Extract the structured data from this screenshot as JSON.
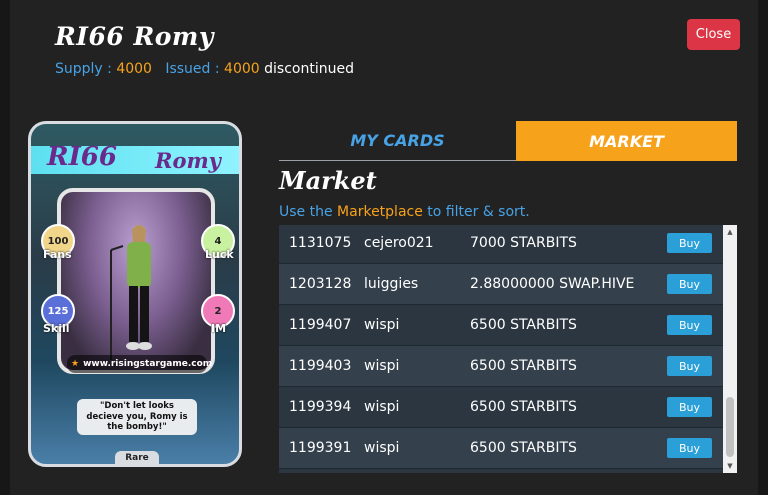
{
  "header": {
    "title": "RI66 Romy",
    "supply_label": "Supply :",
    "supply_value": "4000",
    "issued_label": "Issued :",
    "issued_value": "4000",
    "status": "discontinued",
    "close_label": "Close"
  },
  "card": {
    "code": "RI66",
    "name": "Romy",
    "stats": {
      "fans": {
        "value": "100",
        "label": "Fans"
      },
      "luck": {
        "value": "4",
        "label": "Luck"
      },
      "skill": {
        "value": "125",
        "label": "Skill"
      },
      "im": {
        "value": "2",
        "label": "IM"
      }
    },
    "website": "www.risingstargame.com",
    "quote": "\"Don't let looks decieve you, Romy is the bomby!\"",
    "rarity": "Rare"
  },
  "tabs": {
    "my_cards": "MY CARDS",
    "market": "MARKET"
  },
  "market": {
    "heading": "Market",
    "hint_prefix": "Use the",
    "hint_link": "Marketplace",
    "hint_suffix": "to filter & sort.",
    "buy_label": "Buy",
    "rows": [
      {
        "id": "1131075",
        "seller": "cejero021",
        "price": "7000 STARBITS"
      },
      {
        "id": "1203128",
        "seller": "luiggies",
        "price": "2.88000000 SWAP.HIVE"
      },
      {
        "id": "1199407",
        "seller": "wispi",
        "price": "6500 STARBITS"
      },
      {
        "id": "1199403",
        "seller": "wispi",
        "price": "6500 STARBITS"
      },
      {
        "id": "1199394",
        "seller": "wispi",
        "price": "6500 STARBITS"
      },
      {
        "id": "1199391",
        "seller": "wispi",
        "price": "6500 STARBITS"
      }
    ]
  },
  "colors": {
    "accent_orange": "#f7a21b",
    "accent_blue": "#48a3e6",
    "close_red": "#dc3545",
    "buy_blue": "#2a9fd8"
  }
}
